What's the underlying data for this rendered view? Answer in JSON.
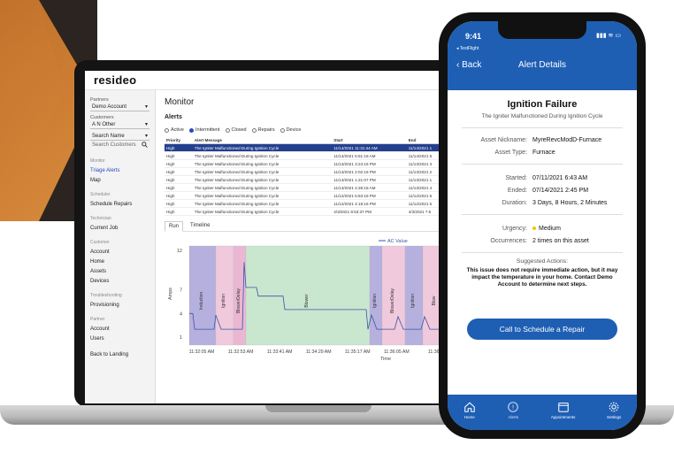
{
  "laptop": {
    "brand": "resideo",
    "sidebar": {
      "partners_label": "Partners",
      "partners_value": "Demo Account",
      "customers_label": "Customers",
      "customers_value": "A N Other",
      "search_by": "Search Name",
      "search_placeholder": "Search Customers",
      "sections": [
        {
          "title": "Monitor",
          "items": [
            "Triage Alerts",
            "Map"
          ]
        },
        {
          "title": "Scheduler",
          "items": [
            "Schedule Repairs"
          ]
        },
        {
          "title": "Technician",
          "items": [
            "Current Job"
          ]
        },
        {
          "title": "Customer",
          "items": [
            "Account",
            "Home",
            "Assets",
            "Devices"
          ]
        },
        {
          "title": "Troubleshooting",
          "items": [
            "Provisioning"
          ]
        },
        {
          "title": "Partner",
          "items": [
            "Account",
            "Users"
          ]
        }
      ],
      "back": "Back to Landing"
    },
    "main": {
      "title": "Monitor",
      "alerts_title": "Alerts",
      "filters": [
        {
          "label": "Active",
          "on": false
        },
        {
          "label": "Intermittent",
          "on": true
        },
        {
          "label": "Closed",
          "on": false
        },
        {
          "label": "Repairs",
          "on": false
        },
        {
          "label": "Device",
          "on": false
        }
      ],
      "table": {
        "headers": [
          "Priority",
          "Alert Message",
          "Start",
          "End"
        ],
        "rows": [
          [
            "High",
            "The Igniter Malfunctioned During Ignition Cycle",
            "11/14/2021 11:31:44 AM",
            "11/14/2021 1"
          ],
          [
            "High",
            "The Igniter Malfunctioned During Ignition Cycle",
            "11/14/2021 5:51:18 AM",
            "11/14/2021 6"
          ],
          [
            "High",
            "The Igniter Malfunctioned During Ignition Cycle",
            "11/13/2021 3:24:16 PM",
            "11/13/2021 3"
          ],
          [
            "High",
            "The Igniter Malfunctioned During Ignition Cycle",
            "11/13/2021 2:02:16 PM",
            "11/13/2021 2"
          ],
          [
            "High",
            "The Igniter Malfunctioned During Ignition Cycle",
            "11/13/2021 1:21:07 PM",
            "11/13/2021 1"
          ],
          [
            "High",
            "The Igniter Malfunctioned During Ignition Cycle",
            "11/13/2021 4:28:18 AM",
            "11/13/2021 4"
          ],
          [
            "High",
            "The Igniter Malfunctioned During Ignition Cycle",
            "11/12/2021 5:53:18 PM",
            "11/12/2021 6"
          ],
          [
            "High",
            "The Igniter Malfunctioned During Ignition Cycle",
            "11/12/2021 4:19:16 PM",
            "11/12/2021 5"
          ],
          [
            "High",
            "The Igniter Malfunctioned During Ignition Cycle",
            "4/3/2021 9:53:37 PM",
            "4/3/2021 7:5"
          ]
        ]
      },
      "tabs": [
        "Run",
        "Timeline"
      ]
    }
  },
  "chart_data": {
    "type": "line",
    "series": [
      {
        "name": "AC Value"
      }
    ],
    "xlabel": "Time",
    "ylabel": "Amps",
    "x_ticks": [
      "11:32:05 AM",
      "11:32:53 AM",
      "11:33:41 AM",
      "11:34:29 AM",
      "11:35:17 AM",
      "11:36:05 AM",
      "11:36:5"
    ],
    "y_ticks": [
      1,
      4,
      7,
      12
    ],
    "bands": [
      {
        "label": "Induction",
        "color": "#b6b0de"
      },
      {
        "label": "Ignition",
        "color": "#f0c9dd"
      },
      {
        "label": "BlowerDelay",
        "color": "#eab7d3"
      },
      {
        "label": "Blower",
        "color": "#c9e6cf"
      },
      {
        "label": "Ignition",
        "color": "#b6b0de"
      },
      {
        "label": "BlowerDelay",
        "color": "#f0c9dd"
      },
      {
        "label": "Ignition",
        "color": "#b6b0de"
      },
      {
        "label": "Blow",
        "color": "#f0c9dd"
      }
    ]
  },
  "phone": {
    "time": "9:41",
    "testflight": "◂ TestFlight",
    "back": "Back",
    "title": "Alert Details",
    "heading": "Ignition Failure",
    "subheading": "The Igniter Malfunctioned During Ignition Cycle",
    "asset_nickname_label": "Asset Nickname:",
    "asset_nickname": "MyreRevcModD-Furnace",
    "asset_type_label": "Asset Type:",
    "asset_type": "Furnace",
    "started_label": "Started:",
    "started": "07/11/2021 6:43 AM",
    "ended_label": "Ended:",
    "ended": "07/14/2021 2:45 PM",
    "duration_label": "Duration:",
    "duration": "3 Days, 8 Hours, 2 Minutes",
    "urgency_label": "Urgency:",
    "urgency": "Medium",
    "urgency_color": "#f2c600",
    "occurrences_label": "Occurrences:",
    "occurrences": "2 times on this asset",
    "suggested_title": "Suggested Actions:",
    "suggested_text": "This issue does not require immediate action, but it may impact the temperature in your home. Contact Demo Account to determine next steps.",
    "cta": "Call to Schedule a Repair",
    "tabbar": [
      "Home",
      "Alerts",
      "Appointments",
      "Settings"
    ],
    "accent": "#1e5fb4"
  }
}
